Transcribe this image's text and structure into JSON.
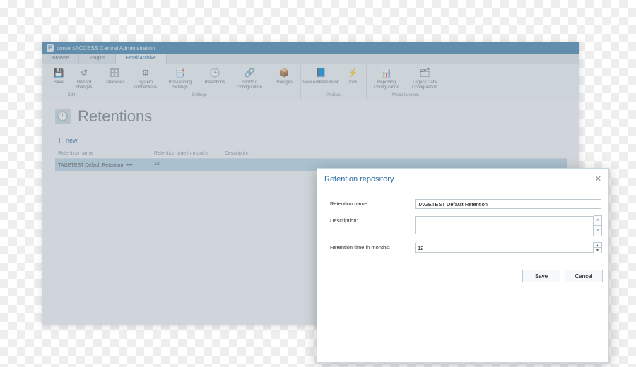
{
  "title": "contentACCESS Central Administration",
  "tabs": [
    "Browse",
    "Plugins",
    "Email Archive"
  ],
  "active_tab": 2,
  "ribbon": {
    "groups": [
      {
        "label": "Edit",
        "items": [
          {
            "icon": "💾",
            "label": "Save"
          },
          {
            "icon": "↺",
            "label": "Discard changes"
          }
        ]
      },
      {
        "label": "Settings",
        "items": [
          {
            "icon": "🗄",
            "label": "Databases"
          },
          {
            "icon": "⚙",
            "label": "System connections"
          },
          {
            "icon": "📑",
            "label": "Provisioning Settings"
          },
          {
            "icon": "🕒",
            "label": "Retentions"
          },
          {
            "icon": "🔗",
            "label": "Shortcut Configuration"
          },
          {
            "icon": "📦",
            "label": "Storages"
          }
        ]
      },
      {
        "label": "Archive",
        "items": [
          {
            "icon": "📘",
            "label": "View Address Book"
          },
          {
            "icon": "⚡",
            "label": "Jobs"
          }
        ]
      },
      {
        "label": "Miscellaneous",
        "items": [
          {
            "icon": "📊",
            "label": "Reporting Configuration"
          },
          {
            "icon": "🗂",
            "label": "Legacy Data Configuration"
          }
        ]
      }
    ]
  },
  "page": {
    "heading": "Retentions",
    "new_label": "new"
  },
  "table": {
    "headers": [
      "Retention name",
      "Retention time in months",
      "Description"
    ],
    "rows": [
      {
        "name": "TAGETEST Default Retention",
        "months": "12",
        "description": ""
      }
    ]
  },
  "dialog": {
    "title": "Retention repository",
    "fields": {
      "name_label": "Retention name:",
      "name_value": "TAGETEST Default Retention",
      "desc_label": "Description:",
      "desc_value": "",
      "months_label": "Retention time in months:",
      "months_value": "12"
    },
    "save": "Save",
    "cancel": "Cancel"
  }
}
